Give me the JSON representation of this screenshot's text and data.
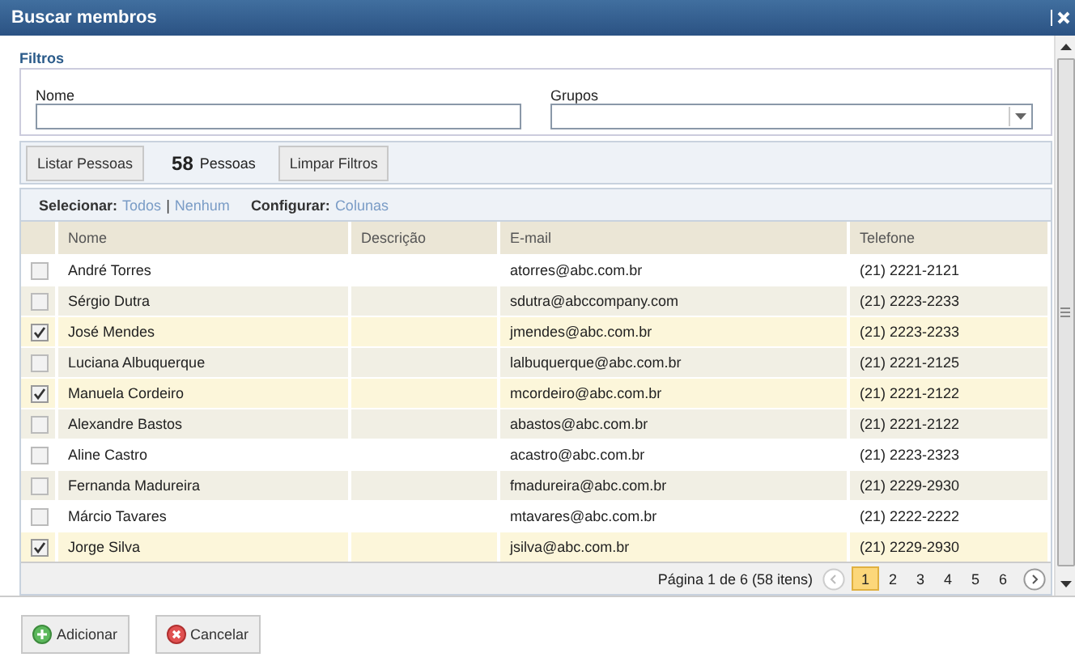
{
  "window": {
    "title": "Buscar membros"
  },
  "filters": {
    "heading": "Filtros",
    "name_label": "Nome",
    "groups_label": "Grupos"
  },
  "toolbar": {
    "list_button": "Listar Pessoas",
    "count": "58",
    "count_label": "Pessoas",
    "clear_button": "Limpar Filtros"
  },
  "selection_bar": {
    "select_label": "Selecionar:",
    "all_link": "Todos",
    "separator": "|",
    "none_link": "Nenhum",
    "configure_label": "Configurar:",
    "columns_link": "Colunas"
  },
  "table": {
    "columns": [
      "Nome",
      "Descrição",
      "E-mail",
      "Telefone"
    ],
    "rows": [
      {
        "checked": false,
        "name": "André Torres",
        "email": "atorres@abc.com.br",
        "phone": "(21) 2221-2121"
      },
      {
        "checked": false,
        "name": "Sérgio Dutra",
        "email": "sdutra@abccompany.com",
        "phone": "(21) 2223-2233"
      },
      {
        "checked": true,
        "name": "José Mendes",
        "email": "jmendes@abc.com.br",
        "phone": "(21) 2223-2233"
      },
      {
        "checked": false,
        "name": "Luciana Albuquerque",
        "email": "lalbuquerque@abc.com.br",
        "phone": "(21) 2221-2125"
      },
      {
        "checked": true,
        "name": "Manuela Cordeiro",
        "email": "mcordeiro@abc.com.br",
        "phone": "(21) 2221-2122"
      },
      {
        "checked": false,
        "name": "Alexandre Bastos",
        "email": "abastos@abc.com.br",
        "phone": "(21) 2221-2122"
      },
      {
        "checked": false,
        "name": "Aline Castro",
        "email": "acastro@abc.com.br",
        "phone": "(21) 2223-2323"
      },
      {
        "checked": false,
        "name": "Fernanda Madureira",
        "email": "fmadureira@abc.com.br",
        "phone": "(21) 2229-2930"
      },
      {
        "checked": false,
        "name": "Márcio Tavares",
        "email": "mtavares@abc.com.br",
        "phone": "(21) 2222-2222"
      },
      {
        "checked": true,
        "name": "Jorge Silva",
        "email": "jsilva@abc.com.br",
        "phone": "(21) 2229-2930"
      }
    ]
  },
  "pager": {
    "summary": "Página 1 de 6 (58 itens)",
    "pages": [
      {
        "label": "1",
        "selected": true
      },
      {
        "label": "2",
        "selected": false
      },
      {
        "label": "3",
        "selected": false
      },
      {
        "label": "4",
        "selected": false
      },
      {
        "label": "5",
        "selected": false
      },
      {
        "label": "6",
        "selected": false
      }
    ]
  },
  "buttons": [
    {
      "kind": "add",
      "label": "Adicionar"
    },
    {
      "kind": "cancel",
      "label": "Cancelar"
    }
  ]
}
